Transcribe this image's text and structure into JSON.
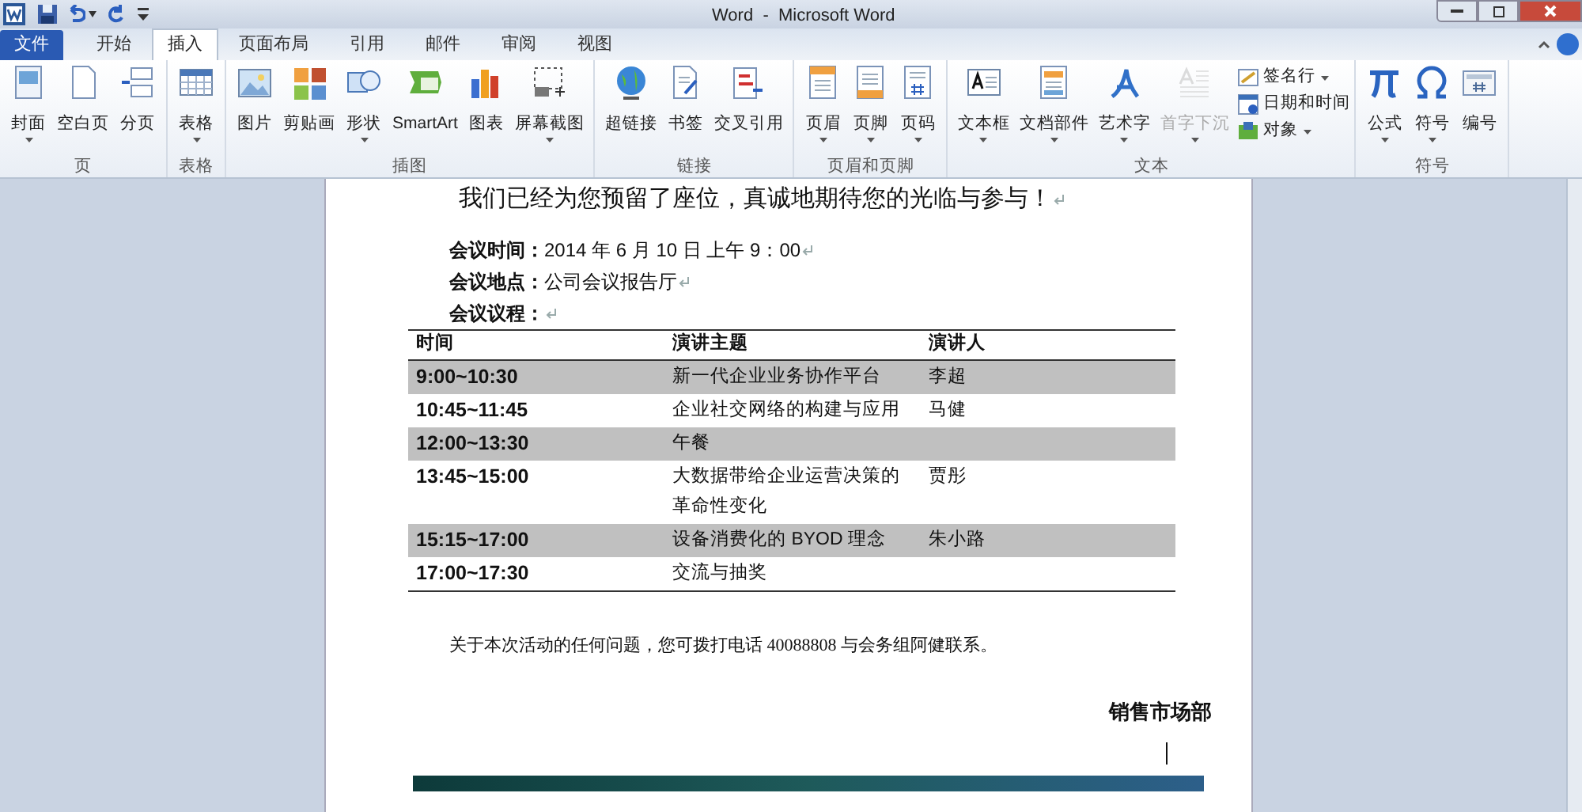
{
  "window": {
    "title": "Word  -  Microsoft Word"
  },
  "tabs": [
    {
      "label": "文件",
      "selected": false,
      "kind": "file"
    },
    {
      "label": "开始",
      "selected": false,
      "kind": "tab"
    },
    {
      "label": "插入",
      "selected": true,
      "kind": "tab"
    },
    {
      "label": "页面布局",
      "selected": false,
      "kind": "tab"
    },
    {
      "label": "引用",
      "selected": false,
      "kind": "tab"
    },
    {
      "label": "邮件",
      "selected": false,
      "kind": "tab"
    },
    {
      "label": "审阅",
      "selected": false,
      "kind": "tab"
    },
    {
      "label": "视图",
      "selected": false,
      "kind": "tab"
    }
  ],
  "ribbon_groups": [
    {
      "label": "页",
      "buttons": [
        {
          "label": "封面",
          "menu": true,
          "disabled": false
        },
        {
          "label": "空白页",
          "menu": false,
          "disabled": false
        },
        {
          "label": "分页",
          "menu": false,
          "disabled": false
        }
      ]
    },
    {
      "label": "表格",
      "buttons": [
        {
          "label": "表格",
          "menu": true,
          "disabled": false
        }
      ]
    },
    {
      "label": "插图",
      "buttons": [
        {
          "label": "图片",
          "menu": false,
          "disabled": false
        },
        {
          "label": "剪贴画",
          "menu": false,
          "disabled": false
        },
        {
          "label": "形状",
          "menu": true,
          "disabled": false
        },
        {
          "label": "SmartArt",
          "menu": false,
          "disabled": false
        },
        {
          "label": "图表",
          "menu": false,
          "disabled": false
        },
        {
          "label": "屏幕截图",
          "menu": true,
          "disabled": false
        }
      ]
    },
    {
      "label": "链接",
      "buttons": [
        {
          "label": "超链接",
          "menu": false,
          "disabled": false
        },
        {
          "label": "书签",
          "menu": false,
          "disabled": false
        },
        {
          "label": "交叉引用",
          "menu": false,
          "disabled": false
        }
      ]
    },
    {
      "label": "页眉和页脚",
      "buttons": [
        {
          "label": "页眉",
          "menu": true,
          "disabled": false
        },
        {
          "label": "页脚",
          "menu": true,
          "disabled": false
        },
        {
          "label": "页码",
          "menu": true,
          "disabled": false
        }
      ]
    },
    {
      "label": "文本",
      "buttons": [
        {
          "label": "文本框",
          "menu": true,
          "disabled": false
        },
        {
          "label": "文档部件",
          "menu": true,
          "disabled": false
        },
        {
          "label": "艺术字",
          "menu": true,
          "disabled": false
        },
        {
          "label": "首字下沉",
          "menu": true,
          "disabled": true
        }
      ],
      "small_buttons": [
        {
          "label": "签名行",
          "menu": true
        },
        {
          "label": "日期和时间",
          "menu": false
        },
        {
          "label": "对象",
          "menu": true
        }
      ]
    },
    {
      "label": "符号",
      "buttons": [
        {
          "label": "公式",
          "menu": true,
          "disabled": false
        },
        {
          "label": "符号",
          "menu": true,
          "disabled": false
        },
        {
          "label": "编号",
          "menu": false,
          "disabled": false
        }
      ]
    }
  ],
  "document": {
    "heading": "我们已经为您预留了座位，真诚地期待您的光临与参与！",
    "fields": [
      {
        "label": "会议时间：",
        "value": "2014 年 6 月 10 日 上午 9：00"
      },
      {
        "label": "会议地点：",
        "value": "公司会议报告厅"
      },
      {
        "label": "会议议程："
      }
    ],
    "table": {
      "columns": [
        "时间",
        "演讲主题",
        "演讲人"
      ],
      "rows": [
        {
          "cells": [
            "9:00~10:30",
            "新一代企业业务协作平台",
            "李超"
          ],
          "shaded": true
        },
        {
          "cells": [
            "10:45~11:45",
            "企业社交网络的构建与应用",
            "马健"
          ],
          "shaded": false
        },
        {
          "cells": [
            "12:00~13:30",
            "午餐",
            ""
          ],
          "shaded": true
        },
        {
          "cells": [
            "13:45~15:00",
            "大数据带给企业运营决策的革命性变化",
            "贾彤"
          ],
          "shaded": false
        },
        {
          "cells": [
            "15:15~17:00",
            "设备消费化的 BYOD 理念",
            "朱小路"
          ],
          "shaded": true
        },
        {
          "cells": [
            "17:00~17:30",
            "交流与抽奖",
            ""
          ],
          "shaded": false
        }
      ]
    },
    "note": "关于本次活动的任何问题，您可拨打电话 40088808 与会务组阿健联系。",
    "signature": "销售市场部"
  }
}
